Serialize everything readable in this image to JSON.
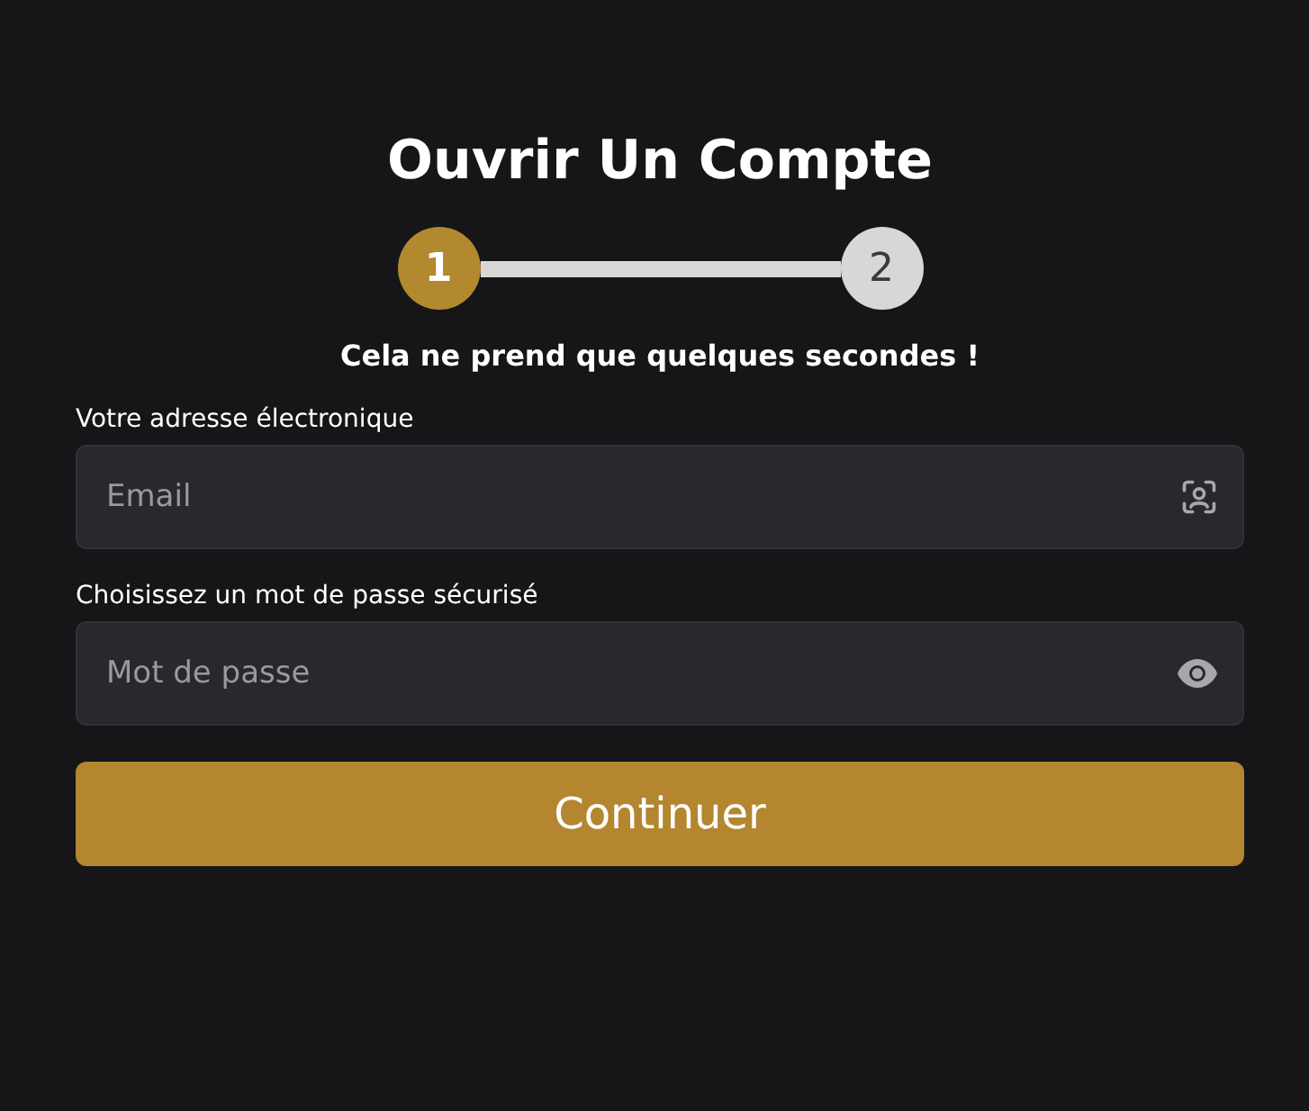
{
  "title": "Ouvrir Un Compte",
  "steps": [
    {
      "label": "1",
      "selected": true
    },
    {
      "label": "2",
      "selected": false
    }
  ],
  "subtitle": "Cela ne prend que quelques secondes !",
  "fields": [
    {
      "label": "Votre adresse électronique",
      "placeholder": "Email",
      "kind": "email"
    },
    {
      "label": "Choisissez un mot de passe sécurisé",
      "placeholder": "Mot de passe",
      "kind": "password"
    }
  ],
  "button": "Continuer"
}
